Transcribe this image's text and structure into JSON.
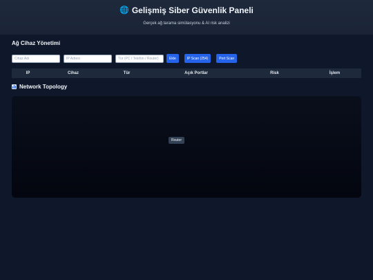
{
  "header": {
    "icon": "globe-icon",
    "title": "Gelişmiş Siber Güvenlik Paneli",
    "subtitle": "Gerçek ağ tarama simülasyonu & AI risk analizi"
  },
  "device_section": {
    "title": "Ağ Cihaz Yönetimi",
    "inputs": {
      "device_name": {
        "placeholder": "Cihaz Adı",
        "value": ""
      },
      "ip_address": {
        "placeholder": "IP Adresi",
        "value": ""
      },
      "device_type": {
        "placeholder": "Tür (PC / Telefon / Router)",
        "value": ""
      }
    },
    "buttons": {
      "add": "Ekle",
      "ip_scan": "IP Scan (254)",
      "port_scan": "Port Scan"
    },
    "table": {
      "columns": [
        "IP",
        "Cihaz",
        "Tür",
        "Açık Portlar",
        "Risk",
        "İşlem"
      ],
      "rows": []
    }
  },
  "topology_section": {
    "icon": "bar-chart-icon",
    "title": "Network Topology",
    "nodes": [
      {
        "label": "Router"
      }
    ]
  },
  "colors": {
    "background": "#0f172a",
    "header": "#1e293b",
    "accent": "#2563eb",
    "canvas": "#050914"
  }
}
